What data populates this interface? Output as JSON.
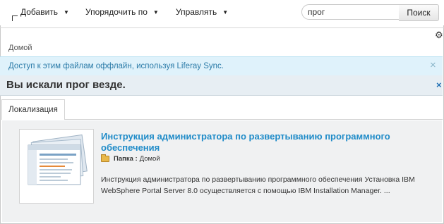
{
  "toolbar": {
    "add_label": "Добавить",
    "sort_label": "Упорядочить по",
    "manage_label": "Управлять",
    "search_value": "прог",
    "search_button": "Поиск"
  },
  "breadcrumb": "Домой",
  "info_banner": "Доступ к этим файлам оффлайн, используя Liferay Sync.",
  "search_header": "Вы искали прог везде.",
  "tabs": [
    {
      "label": "Локализация"
    }
  ],
  "result": {
    "title": "Инструкция администратора по развертыванию программного обеспечения",
    "folder_label": "Папка :",
    "folder_value": "Домой",
    "summary": "Инструкция администратора по развертыванию программного обеспечения Установка IBM WebSphere Portal Server 8.0 осуществляется с помощью IBM Installation Manager. ..."
  },
  "icons": [
    "caret-down-icon",
    "gear-icon",
    "close-icon",
    "folder-icon",
    "document-thumbnail"
  ],
  "colors": {
    "info_bg": "#dff2fb",
    "info_text": "#2b7ba8",
    "link": "#1f8bc8",
    "search_header_bg": "#e7eef3"
  }
}
